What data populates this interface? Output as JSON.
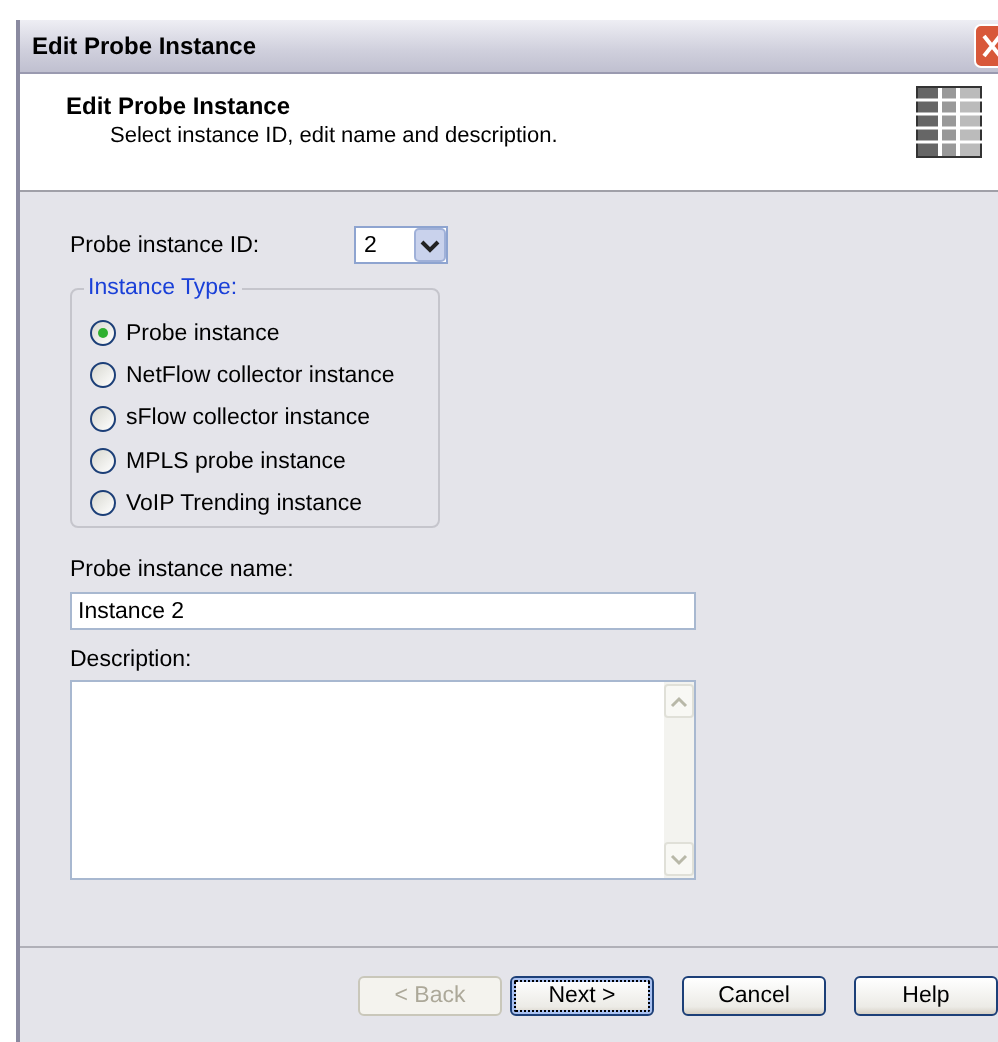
{
  "window": {
    "title": "Edit Probe Instance"
  },
  "header": {
    "title": "Edit Probe Instance",
    "subtitle": "Select instance ID, edit name and description."
  },
  "id_field": {
    "label": "Probe instance ID:",
    "value": "2"
  },
  "instance_type": {
    "legend": "Instance Type:",
    "options": [
      {
        "label": "Probe instance",
        "selected": true
      },
      {
        "label": "NetFlow collector instance",
        "selected": false
      },
      {
        "label": "sFlow collector instance",
        "selected": false
      },
      {
        "label": "MPLS probe instance",
        "selected": false
      },
      {
        "label": "VoIP Trending instance",
        "selected": false
      }
    ]
  },
  "name_field": {
    "label": "Probe instance name:",
    "value": "Instance 2"
  },
  "description_field": {
    "label": "Description:"
  },
  "buttons": [
    {
      "label": "< Back",
      "disabled": true,
      "focused": false
    },
    {
      "label": "Next >",
      "disabled": false,
      "focused": true
    },
    {
      "label": "Cancel",
      "disabled": false,
      "focused": false
    },
    {
      "label": "Help",
      "disabled": false,
      "focused": false
    }
  ]
}
